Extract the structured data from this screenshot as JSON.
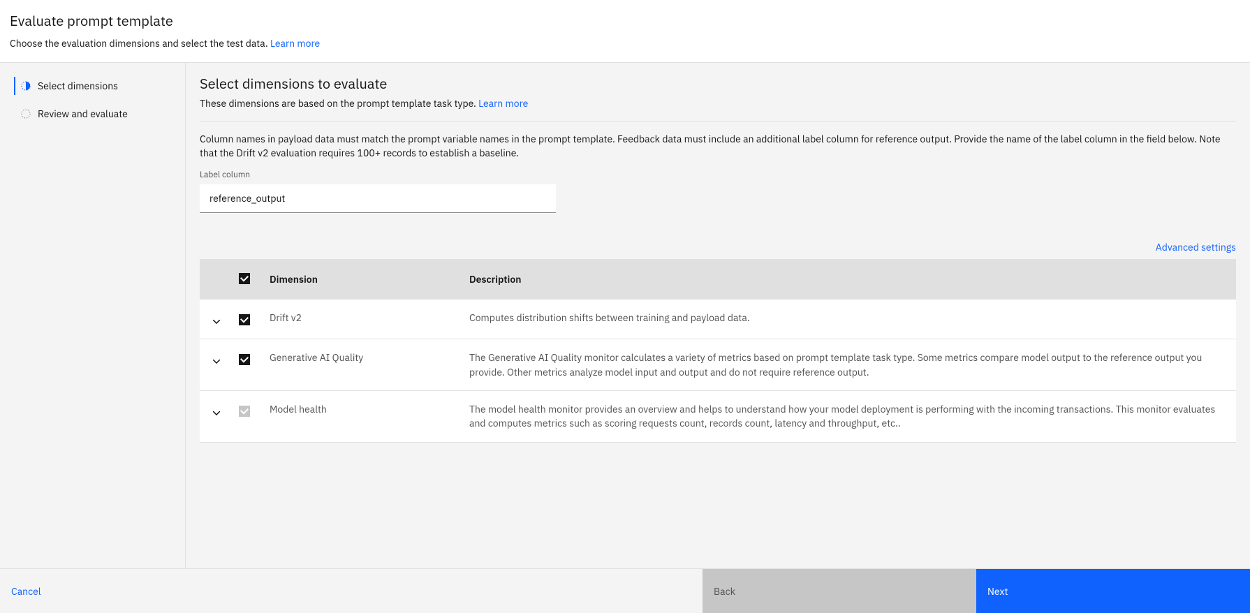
{
  "header": {
    "title": "Evaluate prompt template",
    "subtitle": "Choose the evaluation dimensions and select the test data. ",
    "learn_more": "Learn more"
  },
  "sidebar": {
    "steps": [
      {
        "label": "Select dimensions"
      },
      {
        "label": "Review and evaluate"
      }
    ]
  },
  "main": {
    "title": "Select dimensions to evaluate",
    "subtitle": "These dimensions are based on the prompt template task type. ",
    "learn_more": "Learn more",
    "info": "Column names in payload data must match the prompt variable names in the prompt template. Feedback data must include an additional label column for reference output. Provide the name of the label column in the field below. Note that the Drift v2 evaluation requires 100+ records to establish a baseline.",
    "label_column_label": "Label column",
    "label_column_value": "reference_output",
    "advanced_settings": "Advanced settings",
    "table": {
      "headers": {
        "dimension": "Dimension",
        "description": "Description"
      },
      "rows": [
        {
          "name": "Drift v2",
          "desc": "Computes distribution shifts between training and payload data.",
          "checked": true,
          "disabled": false
        },
        {
          "name": "Generative AI Quality",
          "desc": "The Generative AI Quality monitor calculates a variety of metrics based on prompt template task type. Some metrics compare model output to the reference output you provide. Other metrics analyze model input and output and do not require reference output.",
          "checked": true,
          "disabled": false
        },
        {
          "name": "Model health",
          "desc": "The model health monitor provides an overview and helps to understand how your model deployment is performing with the incoming transactions. This monitor evaluates and computes metrics such as scoring requests count, records count, latency and throughput, etc..",
          "checked": true,
          "disabled": true
        }
      ]
    }
  },
  "footer": {
    "cancel": "Cancel",
    "back": "Back",
    "next": "Next"
  }
}
